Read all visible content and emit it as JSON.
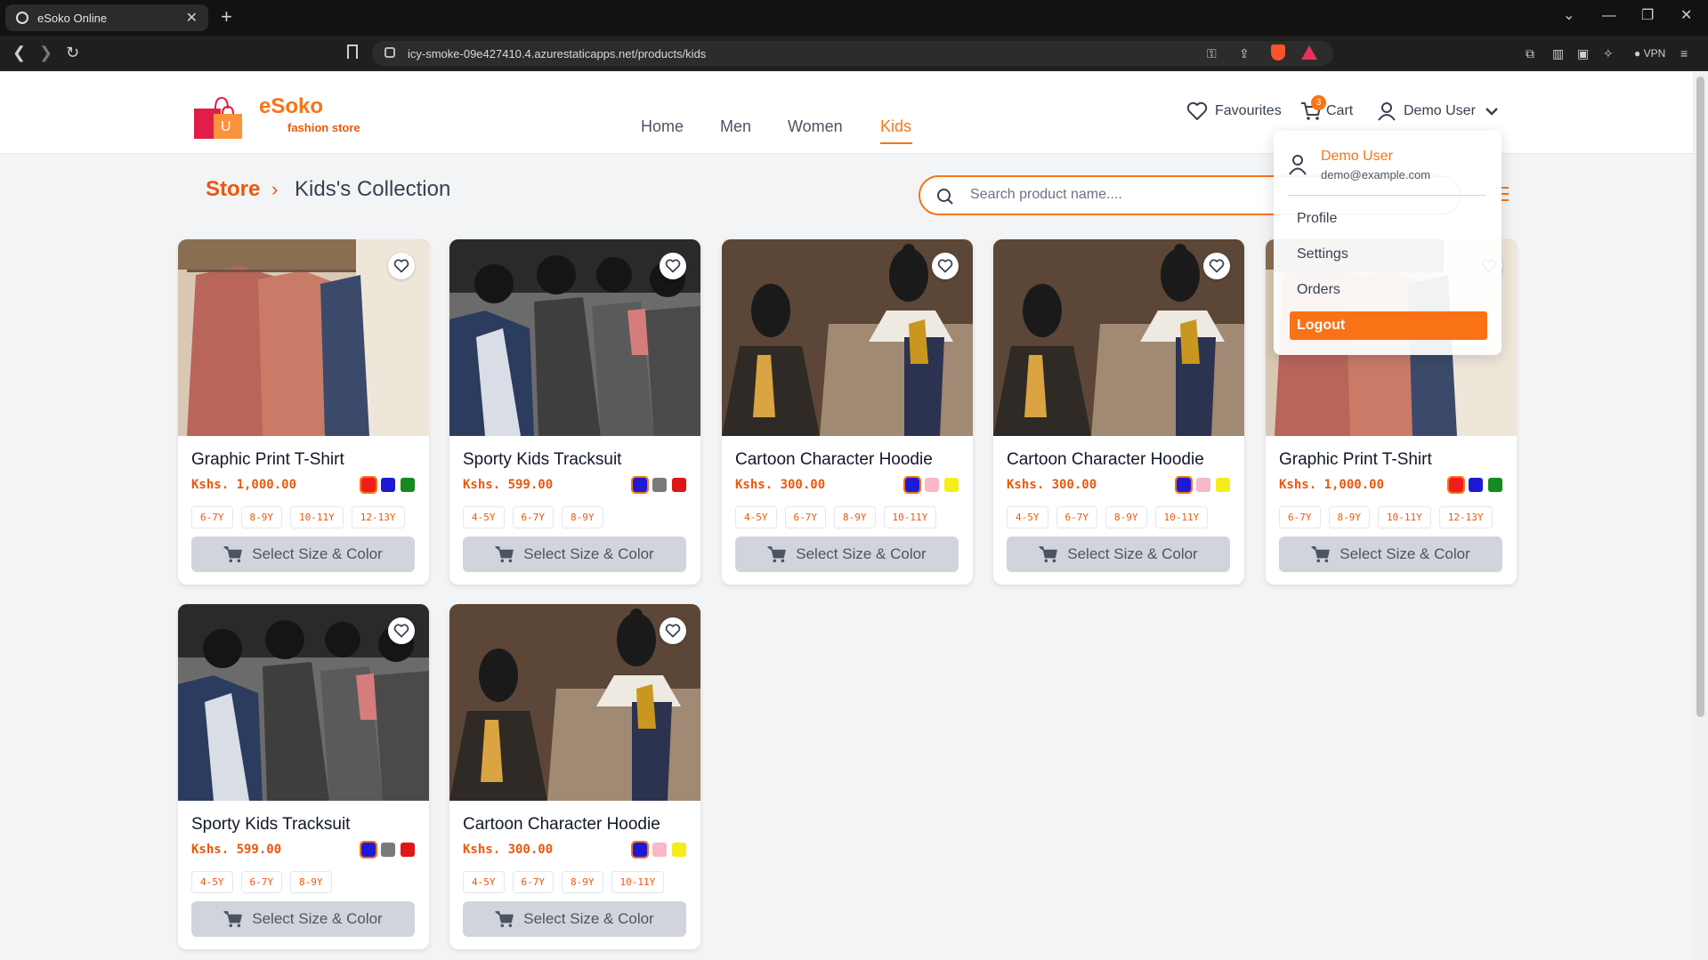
{
  "browser": {
    "tab_title": "eSoko Online",
    "tab_close": "✕",
    "new_tab": "+",
    "url": "icy-smoke-09e427410.4.azurestaticapps.net/products/kids",
    "vpn_label": "VPN"
  },
  "header": {
    "brand": "eSoko",
    "tagline": "fashion store",
    "logo_letter": "U",
    "nav": [
      {
        "label": "Home"
      },
      {
        "label": "Men"
      },
      {
        "label": "Women"
      },
      {
        "label": "Kids"
      }
    ],
    "active_nav": "Kids",
    "favourites_label": "Favourites",
    "cart_label": "Cart",
    "cart_count": "3",
    "user_label": "Demo User"
  },
  "breadcrumb": {
    "store": "Store",
    "separator": "›",
    "current": "Kids's Collection"
  },
  "search": {
    "placeholder": "Search product name...."
  },
  "products": [
    {
      "name": "Graphic Print T-Shirt",
      "price": "Kshs. 1,000.00",
      "colors": [
        "#ef1c1c",
        "#1d1ad6",
        "#168a1f"
      ],
      "sizes": [
        "6-7Y",
        "8-9Y",
        "10-11Y",
        "12-13Y"
      ],
      "cta": "Select Size & Color",
      "image": "closet-shirts"
    },
    {
      "name": "Sporty Kids Tracksuit",
      "price": "Kshs. 599.00",
      "colors": [
        "#1d1ad6",
        "#7a7a7a",
        "#e01616"
      ],
      "sizes": [
        "4-5Y",
        "6-7Y",
        "8-9Y"
      ],
      "cta": "Select Size & Color",
      "image": "suits-rack"
    },
    {
      "name": "Cartoon Character Hoodie",
      "price": "Kshs. 300.00",
      "colors": [
        "#1d1ad6",
        "#f7b8c8",
        "#f6ec1a"
      ],
      "sizes": [
        "4-5Y",
        "6-7Y",
        "8-9Y",
        "10-11Y"
      ],
      "cta": "Select Size & Color",
      "image": "mannequin-tweed"
    },
    {
      "name": "Cartoon Character Hoodie",
      "price": "Kshs. 300.00",
      "colors": [
        "#1d1ad6",
        "#f7b8c8",
        "#f6ec1a"
      ],
      "sizes": [
        "4-5Y",
        "6-7Y",
        "8-9Y",
        "10-11Y"
      ],
      "cta": "Select Size & Color",
      "image": "mannequin-tweed"
    },
    {
      "name": "Graphic Print T-Shirt",
      "price": "Kshs. 1,000.00",
      "colors": [
        "#ef1c1c",
        "#1d1ad6",
        "#168a1f"
      ],
      "sizes": [
        "6-7Y",
        "8-9Y",
        "10-11Y",
        "12-13Y"
      ],
      "cta": "Select Size & Color",
      "image": "closet-shirts"
    },
    {
      "name": "Sporty Kids Tracksuit",
      "price": "Kshs. 599.00",
      "colors": [
        "#1d1ad6",
        "#7a7a7a",
        "#e01616"
      ],
      "sizes": [
        "4-5Y",
        "6-7Y",
        "8-9Y"
      ],
      "cta": "Select Size & Color",
      "image": "suits-rack"
    },
    {
      "name": "Cartoon Character Hoodie",
      "price": "Kshs. 300.00",
      "colors": [
        "#1d1ad6",
        "#f7b8c8",
        "#f6ec1a"
      ],
      "sizes": [
        "4-5Y",
        "6-7Y",
        "8-9Y",
        "10-11Y"
      ],
      "cta": "Select Size & Color",
      "image": "mannequin-tweed"
    }
  ],
  "dropdown": {
    "name": "Demo User",
    "email": "demo@example.com",
    "items": [
      {
        "label": "Profile"
      },
      {
        "label": "Settings"
      },
      {
        "label": "Orders"
      }
    ],
    "logout": "Logout"
  },
  "colors": {
    "accent": "#f97316",
    "accent_dark": "#ea580c",
    "button_disabled": "#d1d5db"
  }
}
